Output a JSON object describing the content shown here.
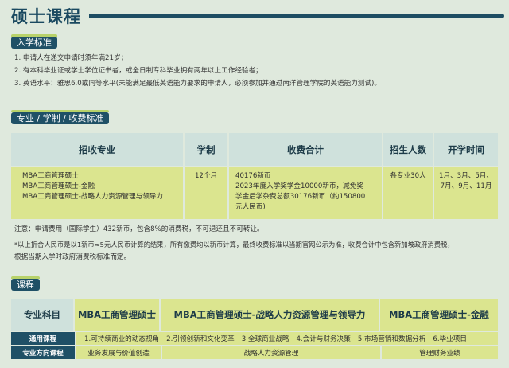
{
  "page": {
    "title": "硕士课程"
  },
  "admission": {
    "heading": "入学标准",
    "items": [
      "1. 申请人在递交申请时须年满21岁；",
      "2. 有本科毕业证或学士学位证书者，或全日制专科毕业拥有两年以上工作经验者；",
      "3. 英语水平：雅思6.0或同等水平(未能满足最低英语能力要求的申请人，必须参加并通过南洋管理学院的英语能力测试)。"
    ]
  },
  "fees": {
    "heading": "专业 / 学制 / 收费标准",
    "headers": [
      "招收专业",
      "学制",
      "收费合计",
      "招生人数",
      "开学时间"
    ],
    "row": {
      "programs": [
        "MBA工商管理硕士",
        "MBA工商管理硕士-金融",
        "MBA工商管理硕士-战略人力资源管理与领导力"
      ],
      "duration": "12个月",
      "fee_lines": [
        "40176新币",
        "2023年度入学奖学金10000新币，减免奖",
        "学金后学杂费总额30176新币（约150800",
        "元人民币)"
      ],
      "enrollment": "各专业30人",
      "intake_lines": [
        "1月、3月、5月、",
        "7月、9月、11月"
      ]
    },
    "notes": [
      "注意：申请费用（国际学生）432新币，包含8%的消费税，不可退还且不可转让。",
      "*以上折合人民币是以1新币≈5元人民币计算的结果，所有缴费均以新币计算，最终收费标准以当期官网公示为准，收费合计中包含新加坡政府消费税，",
      "根据当期入学时政府消费税标准而定。"
    ]
  },
  "courses": {
    "heading": "课程",
    "headers": [
      "专业科目",
      "MBA工商管理硕士",
      "MBA工商管理硕士-战略人力资源管理与领导力",
      "MBA工商管理硕士-金融"
    ],
    "general_label": "通用课程",
    "general_items": [
      "1.可持续商业的动态视角",
      "2.引领创新和文化变革",
      "3.全球商业战略",
      "4.会计与财务决策",
      "5.市场营销和数据分析",
      "6.毕业项目"
    ],
    "direction_label": "专业方向课程",
    "direction_items": [
      "业务发展与价值创造",
      "战略人力资源管理",
      "管理财务业绩"
    ]
  }
}
